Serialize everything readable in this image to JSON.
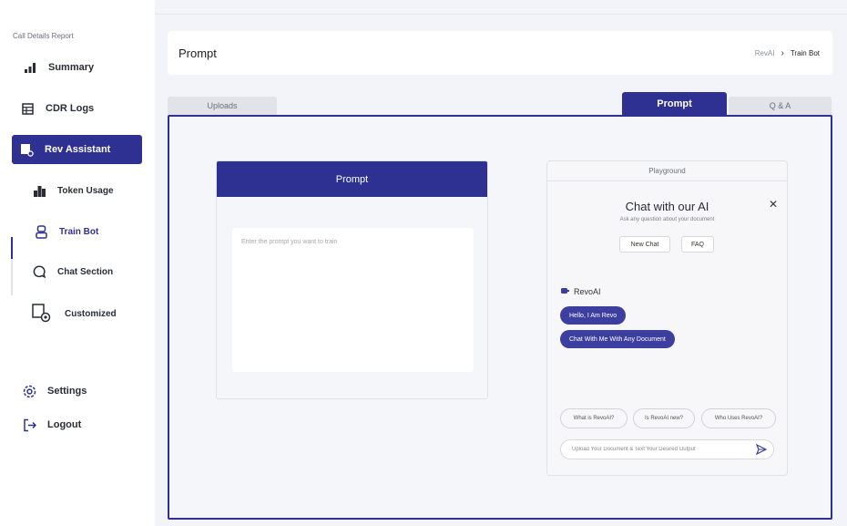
{
  "sidebar": {
    "section_label": "Call Details Report",
    "items": [
      {
        "label": "Summary"
      },
      {
        "label": "CDR Logs"
      },
      {
        "label": "Rev Assistant"
      },
      {
        "label": "Token Usage"
      },
      {
        "label": "Train Bot"
      },
      {
        "label": "Chat Section"
      },
      {
        "label": "Customized"
      },
      {
        "label": "Settings"
      },
      {
        "label": "Logout"
      }
    ]
  },
  "header": {
    "title": "Prompt",
    "breadcrumb": [
      "RevAI",
      "Train Bot"
    ]
  },
  "tabs": [
    {
      "label": "Uploads"
    },
    {
      "label": "Prompt"
    },
    {
      "label": "Q & A"
    }
  ],
  "prompt_card": {
    "title": "Prompt",
    "placeholder": "Enter the prompt you want to train"
  },
  "playground": {
    "title": "Playground",
    "chat_title": "Chat with our AI",
    "chat_subtitle": "Ask any question about your document",
    "new_chat_label": "New Chat",
    "faq_label": "FAQ",
    "bot_name": "RevoAI",
    "messages": [
      "Hello, I Am Revo",
      "Chat With Me With Any Document"
    ],
    "suggestions": [
      "What is RevoAI?",
      "Is RevoAI new?",
      "Who Uses RevoAI?"
    ],
    "input_placeholder": "Upload Your Document & Text Your Desired Output"
  },
  "colors": {
    "accent": "#2e3192",
    "background": "#f2f4f9"
  }
}
